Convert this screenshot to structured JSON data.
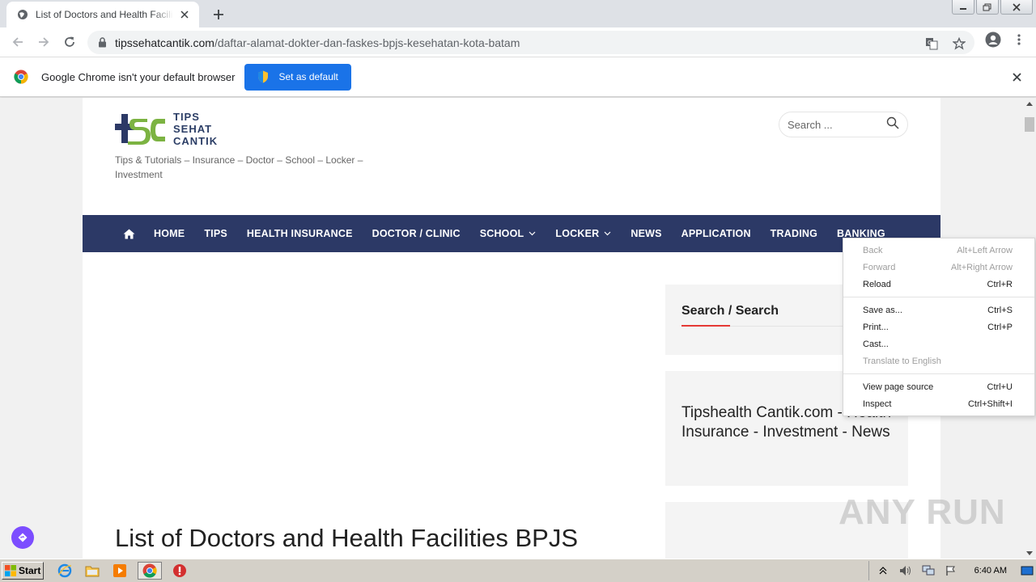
{
  "browser": {
    "tab_title": "List of Doctors and Health Facilities BPJS Kesehatan Kota Batam",
    "url_host": "tipssehatcantik.com",
    "url_path": "/daftar-alamat-dokter-dan-faskes-bpjs-kesehatan-kota-batam"
  },
  "infobar": {
    "message": "Google Chrome isn't your default browser",
    "button_label": "Set as default"
  },
  "site": {
    "logo_line1": "TIPS",
    "logo_line2": "SEHAT",
    "logo_line3": "CANTIK",
    "tagline": "Tips & Tutorials – Insurance – Doctor – School – Locker – Investment",
    "search_placeholder": "Search ..."
  },
  "nav": {
    "items": [
      "HOME",
      "TIPS",
      "HEALTH INSURANCE",
      "DOCTOR / CLINIC",
      "SCHOOL",
      "LOCKER",
      "NEWS",
      "APPLICATION",
      "TRADING",
      "BANKING"
    ]
  },
  "sidebar": {
    "search_widget_title": "Search / Search",
    "promo_text": "Tipshealth Cantik.com - Health Insurance - Investment - News"
  },
  "article": {
    "title": "List of Doctors and Health Facilities BPJS"
  },
  "context_menu": {
    "items": [
      {
        "label": "Back",
        "shortcut": "Alt+Left Arrow"
      },
      {
        "label": "Forward",
        "shortcut": "Alt+Right Arrow"
      },
      {
        "label": "Reload",
        "shortcut": "Ctrl+R"
      },
      {
        "label": "Save as...",
        "shortcut": "Ctrl+S"
      },
      {
        "label": "Print...",
        "shortcut": "Ctrl+P"
      },
      {
        "label": "Cast...",
        "shortcut": ""
      },
      {
        "label": "Translate to English",
        "shortcut": ""
      },
      {
        "label": "View page source",
        "shortcut": "Ctrl+U"
      },
      {
        "label": "Inspect",
        "shortcut": "Ctrl+Shift+I"
      }
    ]
  },
  "taskbar": {
    "start_label": "Start",
    "clock": "6:40 AM"
  },
  "watermark": "ANY RUN",
  "colors": {
    "nav_bg": "#2c3966",
    "chrome_blue": "#1a73e8",
    "accent_red": "#e53935",
    "float_purple": "#7c4dff"
  }
}
